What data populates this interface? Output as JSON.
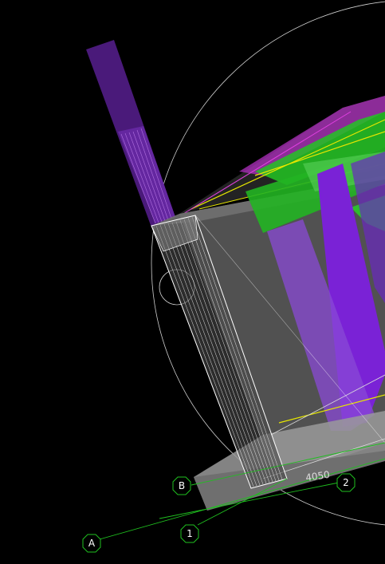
{
  "viewport": {
    "background_color": "#000000",
    "grid_bubbles": [
      {
        "id": "a",
        "label": "A"
      },
      {
        "id": "b",
        "label": "B"
      },
      {
        "id": "1",
        "label": "1"
      },
      {
        "id": "2",
        "label": "2"
      }
    ],
    "dimension_text": "4050",
    "colors": {
      "grid_line": "#1fbf1f",
      "purple_member": "#7a22d6",
      "green_member": "#22c422",
      "yellow_member": "#e6e600",
      "magenta_member": "#d23cd2",
      "wall_panel": "#5a5a5a",
      "wireframe": "#ffffff"
    }
  }
}
